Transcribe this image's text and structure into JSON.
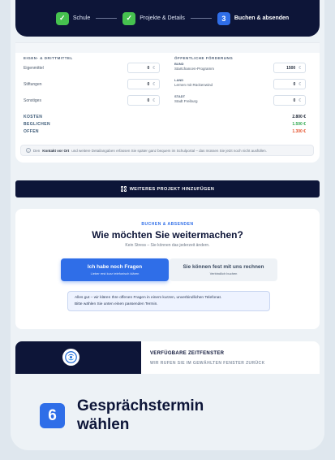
{
  "stepper": {
    "steps": [
      {
        "label": "Schule",
        "state": "done"
      },
      {
        "label": "Projekte & Details",
        "state": "done"
      },
      {
        "number": "3",
        "label": "Buchen & absenden",
        "state": "active"
      }
    ]
  },
  "financing": {
    "left_header": "EIGEN- & DRITTMITTEL",
    "right_header": "ÖFFENTLICHE FÖRDERUNG",
    "currency": "€",
    "left_rows": [
      {
        "label": "Eigenmittel",
        "value": "0"
      },
      {
        "label": "Stiftungen",
        "value": "0"
      },
      {
        "label": "Sonstiges",
        "value": "0"
      }
    ],
    "right_rows": [
      {
        "caption": "BUND",
        "label": "Startchancen-Programm",
        "value": "1500"
      },
      {
        "caption": "LAND",
        "label": "Lernen mit Rückenwind",
        "value": "0"
      },
      {
        "caption": "STADT",
        "label": "Stadt Freiburg",
        "value": "0"
      }
    ],
    "totals": [
      {
        "label": "KOSTEN",
        "value": "2.800 €",
        "color": "#1e2636"
      },
      {
        "label": "BEGLICHEN",
        "value": "1.500 €",
        "color": "#2fa84f"
      },
      {
        "label": "OFFEN",
        "value": "1.300 €",
        "color": "#e5532d"
      }
    ],
    "note_prefix": "Den",
    "note_bold": "Kontakt vor Ort",
    "note_rest": "und weitere Detailangaben erfassen Sie später ganz bequem im Schulportal – das müssen Sie jetzt noch nicht ausfüllen."
  },
  "add_project": {
    "label": "WEITERES PROJEKT HINZUFÜGEN"
  },
  "booking": {
    "kicker": "BUCHEN & ABSENDEN",
    "headline": "Wie möchten Sie weitermachen?",
    "subline": "Kein Stress – Sie können das jederzeit ändern.",
    "primary_title": "Ich habe noch Fragen",
    "primary_sub": "Lieber erst kurz telefonisch klären",
    "secondary_title": "Sie können fest mit uns rechnen",
    "secondary_sub": "Verbindlich buchen",
    "info_line1": "Alles gut – wir klären Ihre offenen Fragen in einem kurzen, unverbindlichen Telefonat.",
    "info_line2": "Bitte wählen Sie unten einen passenden Termin."
  },
  "slots": {
    "title": "VERFÜGBARE ZEITFENSTER",
    "subtitle": "WIR RUFEN SIE IM GEWÄHLTEN FENSTER ZURÜCK"
  },
  "caption": {
    "number": "6",
    "title": "Gesprächstermin wählen"
  },
  "colors": {
    "navy": "#0d1538",
    "accent": "#2f6ee8",
    "success": "#46c24f"
  }
}
